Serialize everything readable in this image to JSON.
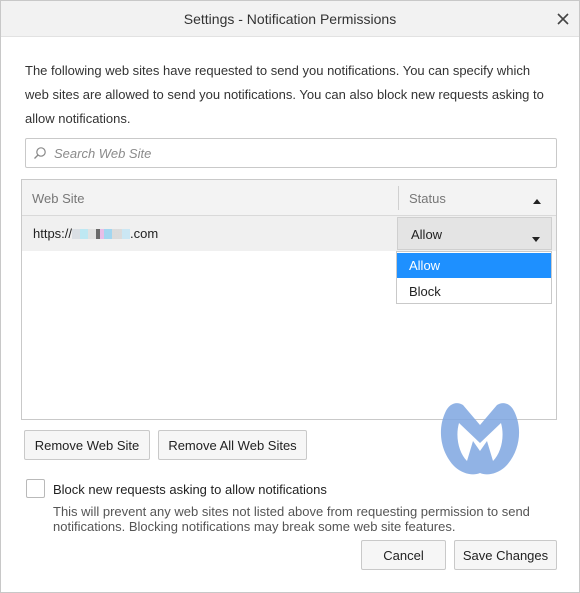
{
  "window": {
    "title": "Settings - Notification Permissions",
    "close_icon": "close-icon"
  },
  "description": "The following web sites have requested to send you notifications. You can specify which web sites are allowed to send you notifications. You can also block new requests asking to allow notifications.",
  "search": {
    "placeholder": "Search Web Site",
    "value": "",
    "icon": "search-icon"
  },
  "table": {
    "columns": [
      "Web Site",
      "Status"
    ],
    "sort_icon": "sort-ascending-icon",
    "rows": [
      {
        "site_prefix": "https://",
        "site_suffix": ".com",
        "status": "Allow"
      }
    ]
  },
  "status_dropdown": {
    "options": [
      "Allow",
      "Block"
    ],
    "selected": "Allow",
    "chevron_icon": "chevron-down-icon"
  },
  "buttons": {
    "remove": "Remove Web Site",
    "remove_all": "Remove All Web Sites",
    "cancel": "Cancel",
    "save": "Save Changes"
  },
  "block_new": {
    "label": "Block new requests asking to allow notifications",
    "checked": false,
    "note": "This will prevent any web sites not listed above from requesting permission to send notifications. Blocking notifications may break some web site features."
  },
  "watermark": {
    "icon": "malwarebytes-logo-icon",
    "color": "#7ea6e0"
  },
  "colors": {
    "accent": "#1e90ff",
    "border": "#c9c9c9",
    "header_bg": "#f3f3f3"
  }
}
